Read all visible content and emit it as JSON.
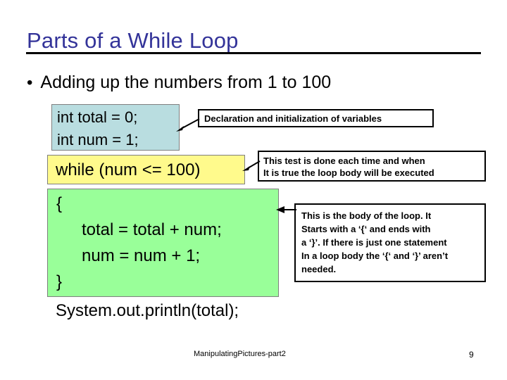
{
  "slide": {
    "title": "Parts of a While Loop",
    "bullet_marker": "•",
    "bullet": "Adding up the numbers from 1 to 100",
    "colors": {
      "title": "#333399",
      "declaration_block": "#b9dde0",
      "condition_block": "#fffa8c",
      "body_block": "#99ff99",
      "text": "#000000",
      "callout_border": "#000000"
    }
  },
  "code": {
    "declaration_block": {
      "lines": [
        "int total = 0;",
        "int num = 1;"
      ]
    },
    "condition_block": {
      "lines": [
        "while (num <= 100)"
      ]
    },
    "body_block": {
      "lines": [
        "{",
        "total = total + num;",
        "num = num + 1;",
        "}"
      ]
    },
    "print_statement": "System.out.println(total);"
  },
  "callouts": {
    "declaration": {
      "lines": [
        "Declaration and initialization of variables"
      ]
    },
    "condition": {
      "lines": [
        "This test is done each time and when",
        "It is true the loop body will be executed"
      ]
    },
    "body": {
      "lines": [
        "This is the body of the loop.  It",
        "Starts with a ‘{‘ and ends with",
        "a ‘}’.  If there is just one statement",
        "In a loop body the ‘{‘ and ‘}’ aren’t",
        "needed."
      ]
    }
  },
  "footer": {
    "document_name": "ManipulatingPictures-part2",
    "page_number": "9"
  }
}
